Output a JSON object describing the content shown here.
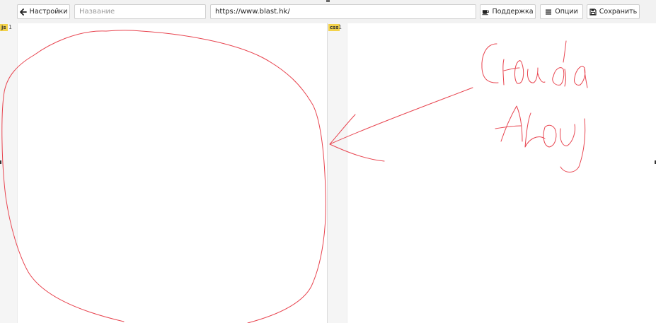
{
  "toolbar": {
    "settings_label": "Настройки",
    "name_placeholder": "Название",
    "url_value": "https://www.blast.hk/",
    "support_label": "Поддержка",
    "options_label": "Опции",
    "save_label": "Сохранить"
  },
  "icons": {
    "settings": "arrow-left-icon",
    "support": "coffee-cup-icon",
    "options": "menu-icon",
    "save": "floppy-disk-icon"
  },
  "editors": {
    "left": {
      "mode": "js",
      "line_number": "1"
    },
    "right": {
      "mode": "css",
      "line_number": "1"
    }
  },
  "annotation": {
    "stroke_color": "#e8444f",
    "handwriting": "Сюда Лоу"
  }
}
